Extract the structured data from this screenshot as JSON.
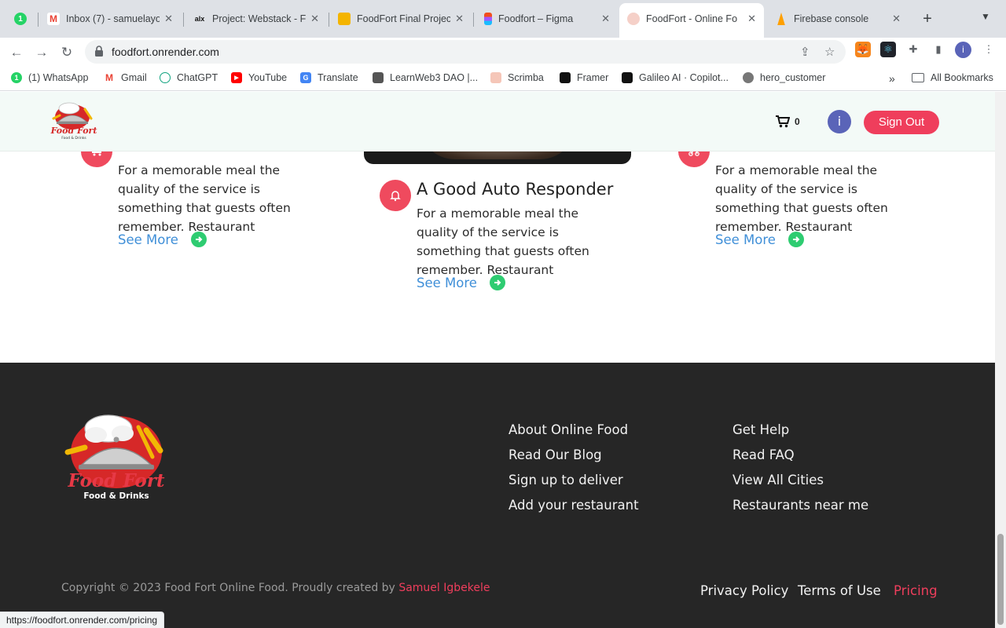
{
  "browser": {
    "tabs": [
      {
        "title": "",
        "badge": "1"
      },
      {
        "title": "Inbox (7) - samuelayo"
      },
      {
        "title": "Project: Webstack - F"
      },
      {
        "title": "FoodFort Final Projec"
      },
      {
        "title": "Foodfort – Figma"
      },
      {
        "title": "FoodFort - Online Fo",
        "active": true
      },
      {
        "title": "Firebase console"
      }
    ],
    "new_tab": "+",
    "url": "foodfort.onrender.com",
    "profile_initial": "i",
    "bookmarks": [
      {
        "label": "(1) WhatsApp"
      },
      {
        "label": "Gmail"
      },
      {
        "label": "ChatGPT"
      },
      {
        "label": "YouTube"
      },
      {
        "label": "Translate"
      },
      {
        "label": "LearnWeb3 DAO |..."
      },
      {
        "label": "Scrimba"
      },
      {
        "label": "Framer"
      },
      {
        "label": "Galileo AI · Copilot..."
      },
      {
        "label": "hero_customer"
      }
    ],
    "bookmarks_more": "»",
    "all_bookmarks": "All Bookmarks",
    "status_url": "https://foodfort.onrender.com/pricing"
  },
  "header": {
    "cart_count": "0",
    "avatar_initial": "i",
    "sign_out": "Sign Out"
  },
  "features": {
    "left": {
      "text": "For a memorable meal the quality of the service is something that guests often remember. Restaurant",
      "see_more": "See More"
    },
    "center": {
      "title": "A Good Auto Responder",
      "text": "For a memorable meal the quality of the service is something that guests often remember. Restaurant",
      "see_more": "See More"
    },
    "right": {
      "text": "For a memorable meal the quality of the service is something that guests often remember. Restaurant",
      "see_more": "See More"
    }
  },
  "footer": {
    "col1": [
      "About Online Food",
      "Read Our Blog",
      "Sign up to deliver",
      "Add your restaurant"
    ],
    "col2": [
      "Get Help",
      "Read FAQ",
      "View All Cities",
      "Restaurants near me"
    ],
    "copyright_prefix": "Copyright © 2023 Food Fort Online Food. Proudly created by",
    "author": "Samuel Igbekele",
    "legal": {
      "privacy": "Privacy Policy",
      "terms": "Terms of Use",
      "pricing": "Pricing"
    },
    "logo_text": "Food Fort",
    "logo_sub": "Food & Drinks"
  },
  "colors": {
    "accent": "#ef3e5c",
    "link": "#3f8fd8",
    "arrow": "#2ecc71",
    "footer_bg": "#262626"
  }
}
